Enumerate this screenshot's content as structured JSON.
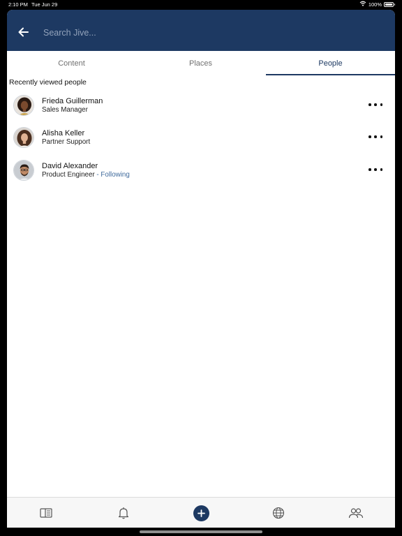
{
  "status_bar": {
    "time": "2:10 PM",
    "date": "Tue Jun 29",
    "battery": "100%",
    "icons": [
      "wifi-icon",
      "battery-icon"
    ]
  },
  "header": {
    "search_placeholder": "Search Jive...",
    "search_value": "",
    "back_icon": "arrow-left-icon",
    "background_color": "#1d3962"
  },
  "tabs": [
    {
      "label": "Content",
      "selected": false
    },
    {
      "label": "Places",
      "selected": false
    },
    {
      "label": "People",
      "selected": true
    }
  ],
  "section_title": "Recently viewed people",
  "people": [
    {
      "name": "Frieda Guillerman",
      "title": "Sales Manager",
      "status": "",
      "avatar": "avatar-photo"
    },
    {
      "name": "Alisha Keller",
      "title": "Partner Support",
      "status": "",
      "avatar": "avatar-photo"
    },
    {
      "name": "David Alexander",
      "title": "Product Engineer",
      "status": " - Following",
      "avatar": "avatar-photo"
    }
  ],
  "bottom_nav": [
    {
      "icon": "news-icon"
    },
    {
      "icon": "bell-icon"
    },
    {
      "icon": "plus-circle-icon"
    },
    {
      "icon": "globe-icon"
    },
    {
      "icon": "people-icon"
    }
  ],
  "colors": {
    "accent": "#1d3962",
    "following": "#3f6a9c"
  }
}
